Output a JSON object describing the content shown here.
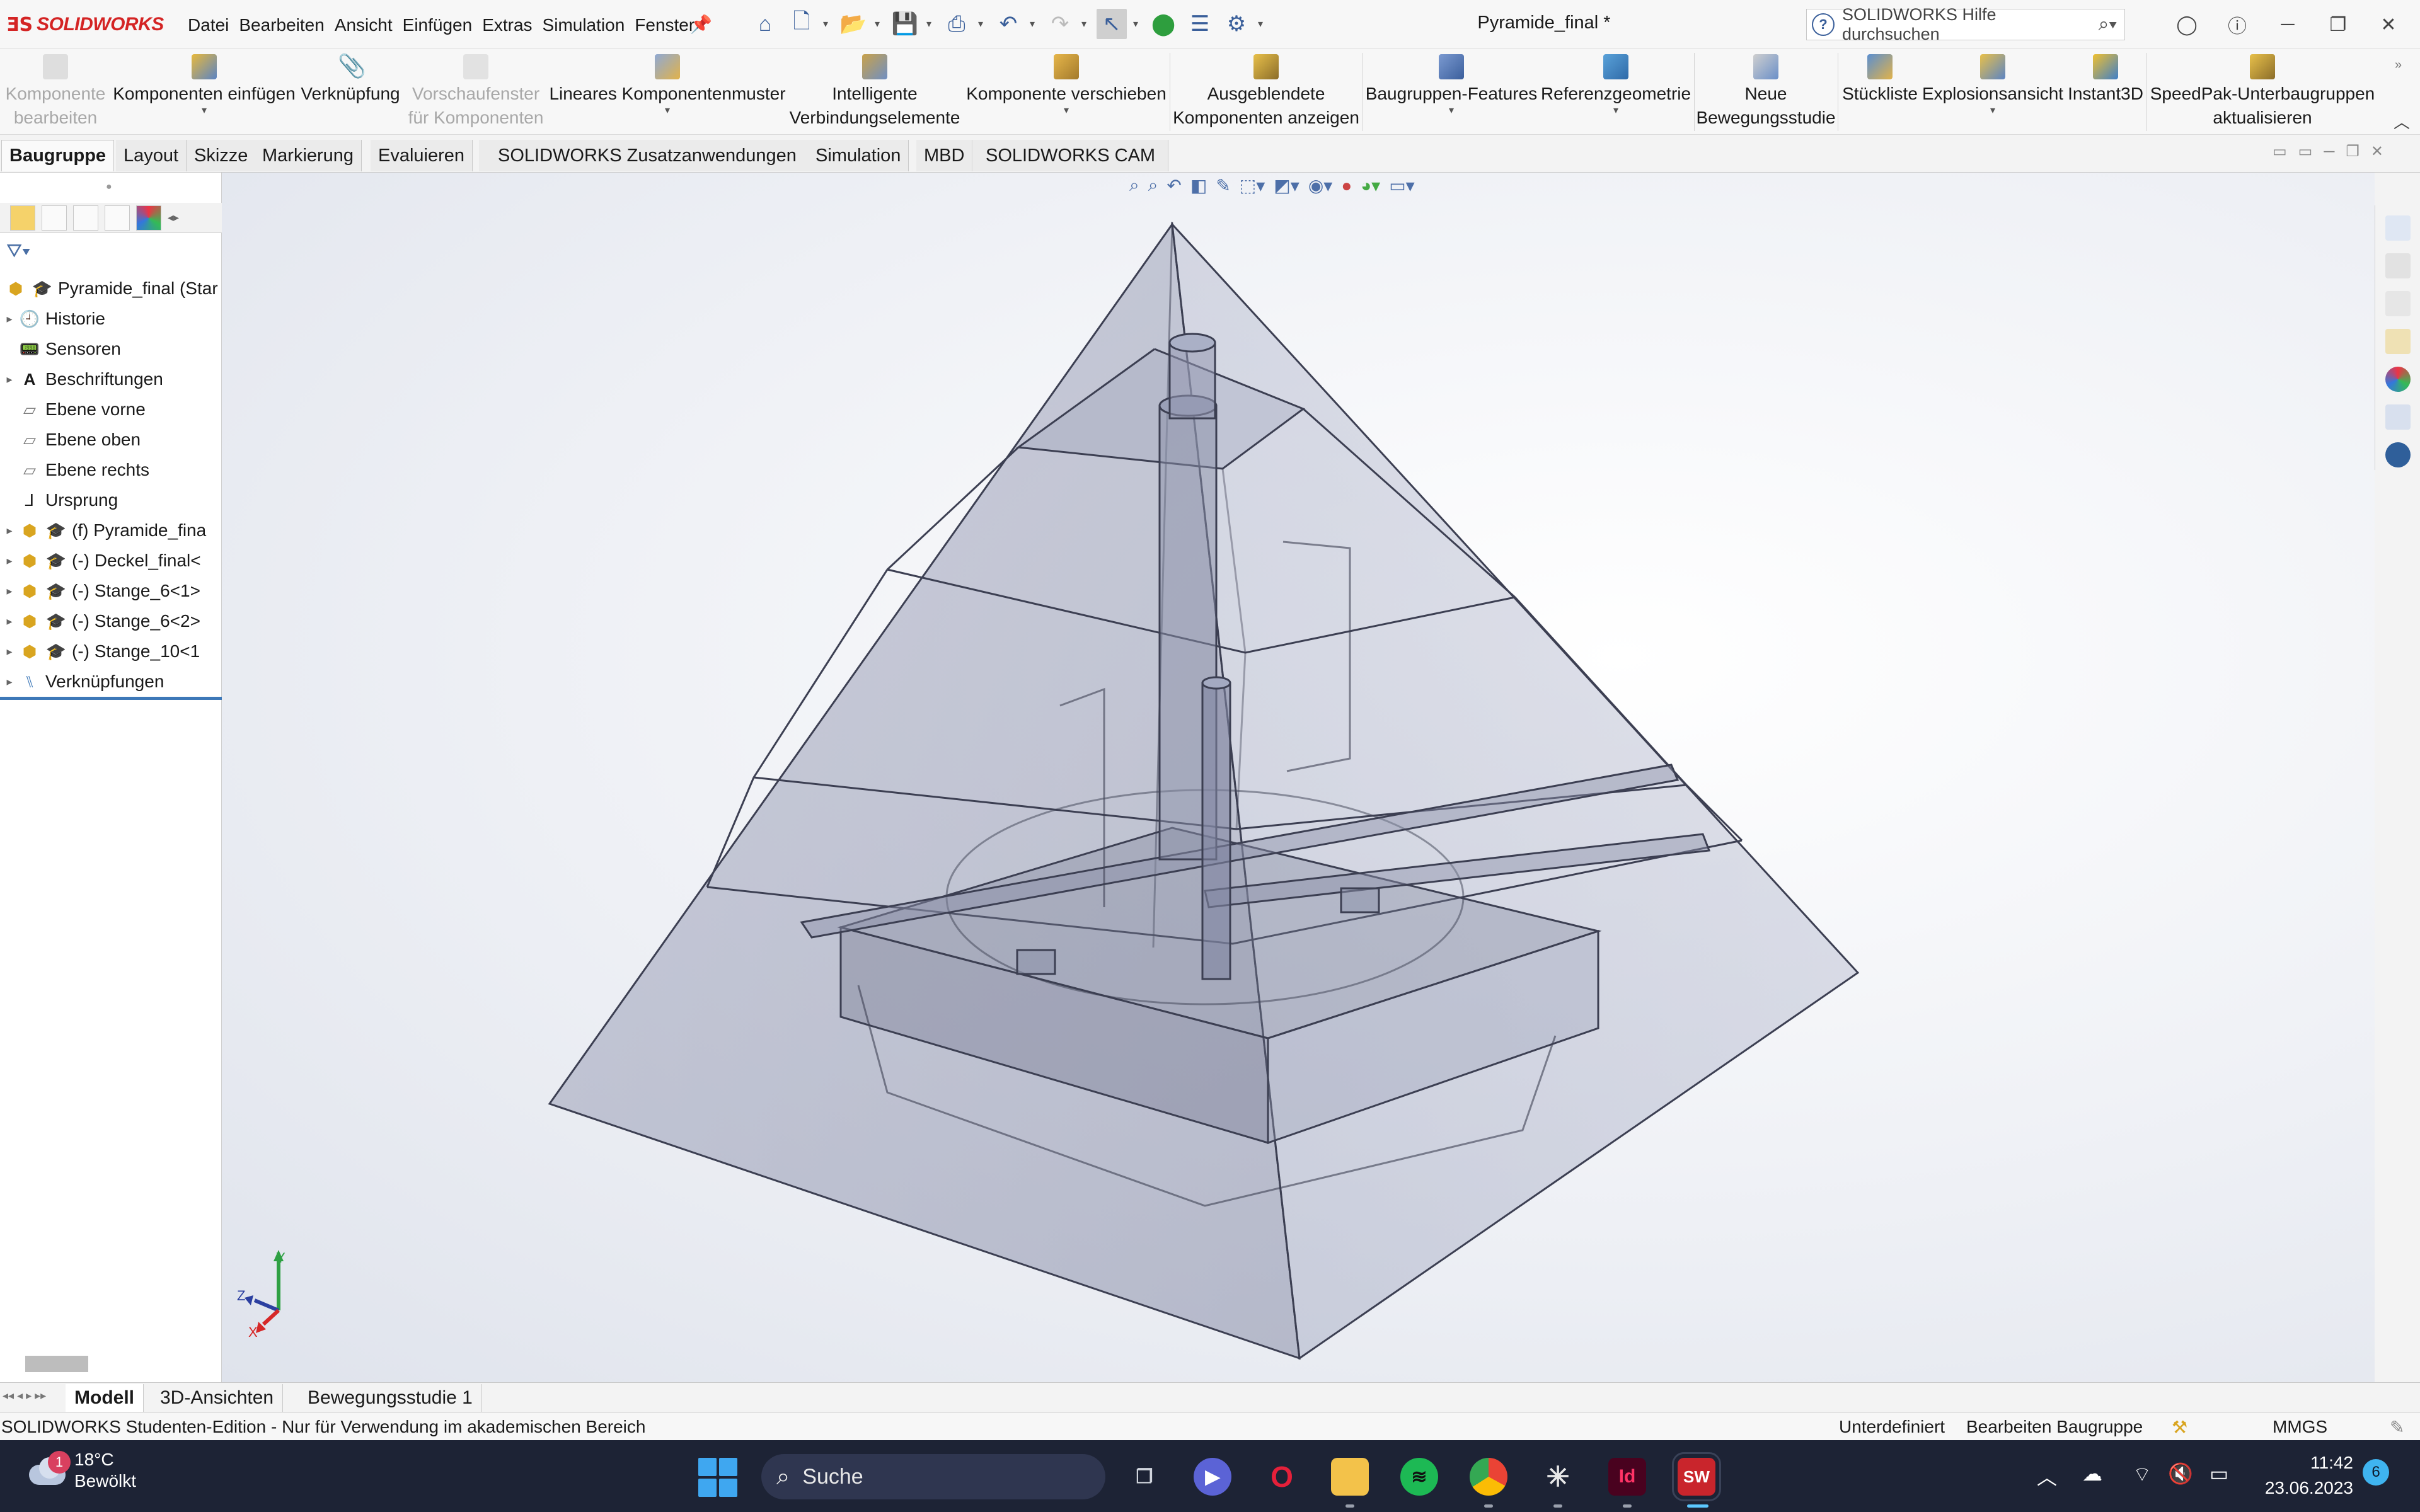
{
  "app": {
    "brand": "SOLIDWORKS",
    "document_title": "Pyramide_final *"
  },
  "menu": [
    "Datei",
    "Bearbeiten",
    "Ansicht",
    "Einfügen",
    "Extras",
    "Simulation",
    "Fenster"
  ],
  "help_search": {
    "placeholder": "SOLIDWORKS Hilfe durchsuchen"
  },
  "ribbon": {
    "komponente_bearbeiten": "Komponente bearbeiten",
    "komponenten_einfuegen": "Komponenten einfügen",
    "verknuepfung": "Verknüpfung",
    "vorschaufenster": "Vorschaufenster für Komponenten",
    "lineares_muster": "Lineares Komponentenmuster",
    "intelligente": "Intelligente Verbindungselemente",
    "komponente_verschieben": "Komponente verschieben",
    "ausgeblendete": "Ausgeblendete Komponenten anzeigen",
    "baugruppen_features": "Baugruppen-Features",
    "referenzgeometrie": "Referenzgeometrie",
    "neue_bewegungsstudie": "Neue Bewegungsstudie",
    "stueckliste": "Stückliste",
    "explosionsansicht": "Explosionsansicht",
    "instant3d": "Instant3D",
    "speedpak": "SpeedPak-Unterbaugruppen aktualisieren"
  },
  "command_tabs": [
    "Baugruppe",
    "Layout",
    "Skizze",
    "Markierung",
    "Evaluieren",
    "SOLIDWORKS Zusatzanwendungen",
    "Simulation",
    "MBD",
    "SOLIDWORKS CAM"
  ],
  "tree": {
    "root": "Pyramide_final (Star",
    "historie": "Historie",
    "sensoren": "Sensoren",
    "beschriftungen": "Beschriftungen",
    "ebene_vorne": "Ebene vorne",
    "ebene_oben": "Ebene oben",
    "ebene_rechts": "Ebene rechts",
    "ursprung": "Ursprung",
    "pyramide": "(f) Pyramide_fina",
    "deckel": "(-) Deckel_final<",
    "stange6_1": "(-) Stange_6<1>",
    "stange6_2": "(-) Stange_6<2>",
    "stange10": "(-) Stange_10<1",
    "verknuepfungen": "Verknüpfungen"
  },
  "triad": {
    "x": "X",
    "y": "Y",
    "z": "Z"
  },
  "bottom_tabs": [
    "Modell",
    "3D-Ansichten",
    "Bewegungsstudie 1"
  ],
  "status": {
    "edition": "SOLIDWORKS Studenten-Edition - Nur für Verwendung im akademischen Bereich",
    "definition": "Unterdefiniert",
    "editing": "Bearbeiten Baugruppe",
    "units": "MMGS"
  },
  "taskbar": {
    "temperature": "18°C",
    "weather": "Bewölkt",
    "weather_badge": "1",
    "search_label": "Suche",
    "time": "11:42",
    "date": "23.06.2023",
    "notifications": "6"
  },
  "colors": {
    "brand_red": "#d42424",
    "accent_blue": "#3d78b8",
    "taskbar_bg": "#1d2335"
  }
}
